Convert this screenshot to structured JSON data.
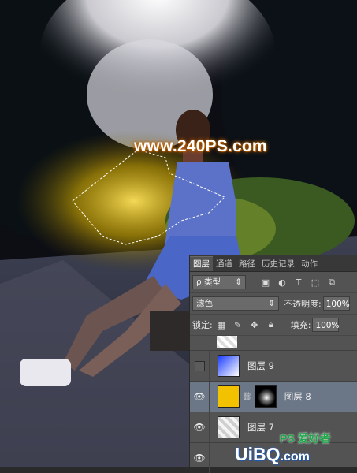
{
  "photo": {
    "watermark": "www.240PS.com"
  },
  "panel": {
    "tabs": [
      {
        "label": "图层",
        "active": true
      },
      {
        "label": "通道",
        "active": false
      },
      {
        "label": "路径",
        "active": false
      },
      {
        "label": "历史记录",
        "active": false
      },
      {
        "label": "动作",
        "active": false
      }
    ],
    "filter": {
      "label": "类型",
      "prefix": "ρ"
    },
    "blend_mode": "滤色",
    "opacity": {
      "label": "不透明度:",
      "value": "100%"
    },
    "lock": {
      "label": "锁定:"
    },
    "fill": {
      "label": "填充:",
      "value": "100%"
    },
    "layers": [
      {
        "name": "图层 9",
        "visible": false,
        "selected": false
      },
      {
        "name": "图层 8",
        "visible": true,
        "selected": true
      },
      {
        "name": "图层 7",
        "visible": true,
        "selected": false
      }
    ]
  },
  "corner_watermark": {
    "ps": "PS 爱好者",
    "uibq": "UiBQ",
    "suffix": ".com"
  }
}
